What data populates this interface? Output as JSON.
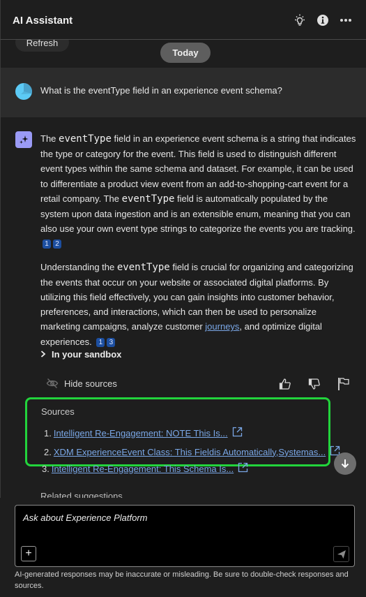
{
  "header": {
    "title": "AI Assistant",
    "icons": [
      "lightbulb-icon",
      "info-icon",
      "more-options-icon"
    ]
  },
  "conversation": {
    "refresh_label": "Refresh",
    "date_divider": "Today",
    "user_message": "What is the eventType field in an experience event schema?",
    "ai_response": {
      "p1": {
        "t1": "The ",
        "code1": "eventType",
        "t2": " field in an experience event schema is a string that indicates the type or category for the event. This field is used to distinguish different event types within the same schema and dataset. For example, it can be used to differentiate a product view event from an add-to-shopping-cart event for a retail company. The ",
        "code2": "eventType",
        "t3": " field is automatically populated by the system upon data ingestion and is an extensible enum, meaning that you can also use your own event type strings to categorize the events you are tracking.",
        "citations": [
          "1",
          "2"
        ]
      },
      "p2": {
        "t1": "Understanding the ",
        "code1": "eventType",
        "t2": " field is crucial for organizing and categorizing the events that occur on your website or associated digital platforms. By utilizing this field effectively, you can gain insights into customer behavior, preferences, and interactions, which can then be used to personalize marketing campaigns, analyze customer ",
        "link": "journeys",
        "t3": ", and optimize digital experiences.",
        "citations": [
          "1",
          "3"
        ]
      }
    },
    "sandbox_label": "In your sandbox",
    "hide_sources_label": "Hide sources",
    "sources": {
      "heading": "Sources",
      "items": [
        {
          "num": "1.",
          "title": "Intelligent Re-Engagement: NOTE This Is..."
        },
        {
          "num": "2.",
          "title": "XDM ExperienceEvent Class: This Fieldis Automatically,Systemas..."
        },
        {
          "num": "3.",
          "title": "Intelligent Re-Engagement: This Schema Is..."
        }
      ]
    },
    "related_label": "Related suggestions"
  },
  "composer": {
    "placeholder": "Ask about Experience Platform",
    "add_label": "+"
  },
  "disclaimer": "AI-generated responses may be inaccurate or misleading. Be sure to double-check responses and sources.",
  "colors": {
    "background": "#1e1e1e",
    "user_bubble": "#2c2c2c",
    "ai_avatar": "#9a9af5",
    "citation": "#1d4fa0",
    "link": "#7aa7e6",
    "highlight_border": "#22d43c"
  }
}
